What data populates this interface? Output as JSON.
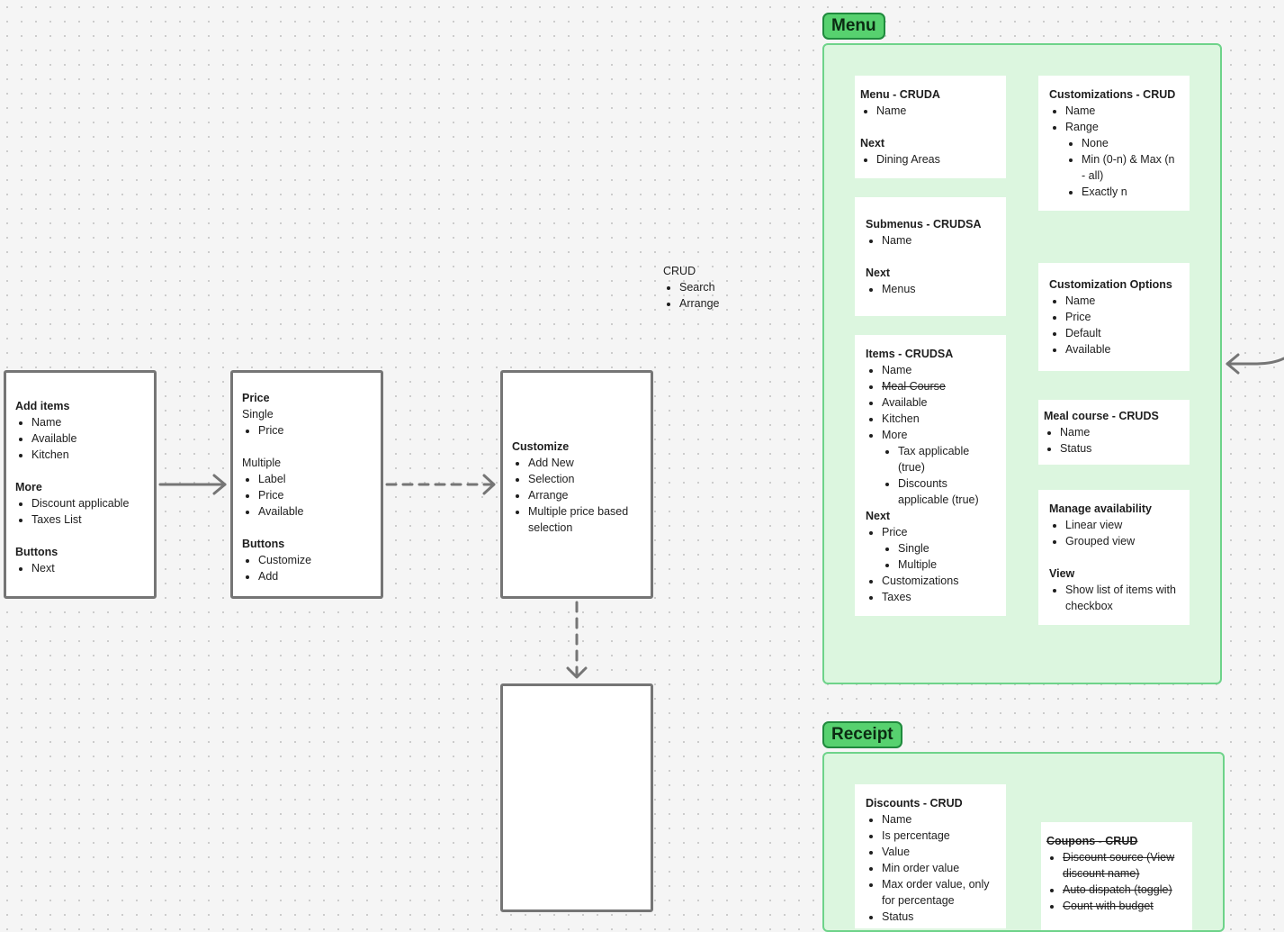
{
  "flow": {
    "add_items": {
      "title": "Add items",
      "fields": [
        "Name",
        "Available",
        "Kitchen"
      ],
      "more_title": "More",
      "more": [
        "Discount applicable",
        "Taxes List"
      ],
      "buttons_title": "Buttons",
      "buttons": [
        "Next"
      ]
    },
    "price": {
      "title": "Price",
      "single_title": "Single",
      "single": [
        "Price"
      ],
      "multiple_title": "Multiple",
      "multiple": [
        "Label",
        "Price",
        "Available"
      ],
      "buttons_title": "Buttons",
      "buttons": [
        "Customize",
        "Add"
      ]
    },
    "customize": {
      "title": "Customize",
      "items": [
        "Add New",
        "Selection",
        "Arrange",
        "Multiple price based selection"
      ]
    }
  },
  "crud_note": {
    "title": "CRUD",
    "items": [
      "Search",
      "Arrange"
    ]
  },
  "menu_section": {
    "label": "Menu",
    "menu_card": {
      "title": "Menu - CRUDA",
      "fields": [
        "Name"
      ],
      "next_title": "Next",
      "next": [
        "Dining Areas"
      ]
    },
    "submenus_card": {
      "title": "Submenus - CRUDSA",
      "fields": [
        "Name"
      ],
      "next_title": "Next",
      "next": [
        "Menus"
      ]
    },
    "items_card": {
      "title": "Items - CRUDSA",
      "name": "Name",
      "meal_course": "Meal Course",
      "available": "Available",
      "kitchen": "Kitchen",
      "more": "More",
      "more_sub": [
        "Tax applicable (true)",
        "Discounts applicable (true)"
      ],
      "next_title": "Next",
      "price": "Price",
      "price_sub": [
        "Single",
        "Multiple"
      ],
      "customizations": "Customizations",
      "taxes": "Taxes"
    },
    "customizations_card": {
      "title": "Customizations - CRUD",
      "name": "Name",
      "range": "Range",
      "range_sub": [
        "None",
        "Min (0-n) & Max (n - all)",
        "Exactly n"
      ]
    },
    "options_card": {
      "title": "Customization Options",
      "fields": [
        "Name",
        "Price",
        "Default",
        "Available"
      ]
    },
    "meal_course_card": {
      "title": "Meal course - CRUDS",
      "fields": [
        "Name",
        "Status"
      ]
    },
    "availability_card": {
      "title": "Manage availability",
      "fields": [
        "Linear view",
        "Grouped view"
      ],
      "view_title": "View",
      "view": [
        "Show list of items with checkbox"
      ]
    }
  },
  "receipt_section": {
    "label": "Receipt",
    "discounts_card": {
      "title": "Discounts - CRUD",
      "fields": [
        "Name",
        "Is percentage",
        "Value",
        "Min order value",
        "Max order value, only for percentage",
        "Status"
      ]
    },
    "coupons_card": {
      "title": "Coupons - CRUD",
      "fields": [
        "Discount source (View discount name)",
        "Auto dispatch (toggle)",
        "Count with budget"
      ]
    }
  },
  "colors": {
    "section_fill": "#dcf6df",
    "section_border": "#6ed38a",
    "label_fill": "#57d16f",
    "connector": "#757575"
  }
}
